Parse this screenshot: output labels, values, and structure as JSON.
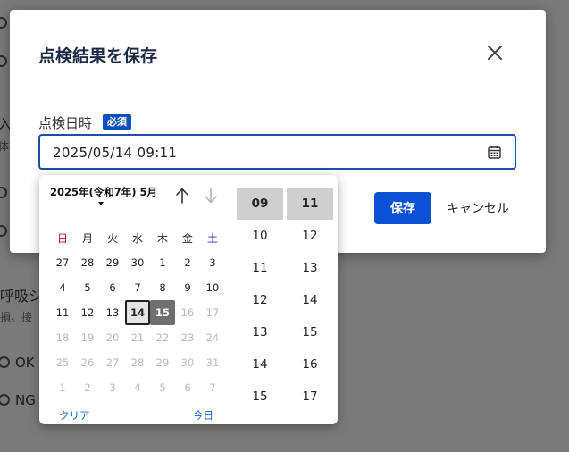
{
  "background": {
    "frag_a": "入",
    "frag_b": "体",
    "frag_c": "呼吸シ",
    "frag_d": "損、接",
    "ok_label": "OK",
    "ng_label": "NG"
  },
  "dialog": {
    "title": "点検結果を保存",
    "close_icon": "close-icon",
    "field_label": "点検日時",
    "required_badge": "必須",
    "datetime_value": "2025/05/14 09:11",
    "calendar_icon": "calendar-icon",
    "save_label": "保存",
    "cancel_label": "キャンセル",
    "accent_color": "#0a52d3"
  },
  "picker": {
    "month_label": "2025年(令和7年) 5月",
    "prev_icon": "arrow-up-icon",
    "next_icon": "arrow-down-icon",
    "weekdays": [
      "日",
      "月",
      "火",
      "水",
      "木",
      "金",
      "土"
    ],
    "weeks": [
      [
        {
          "d": "27",
          "m": "cur"
        },
        {
          "d": "28",
          "m": "cur"
        },
        {
          "d": "29",
          "m": "cur"
        },
        {
          "d": "30",
          "m": "cur"
        },
        {
          "d": "1",
          "m": "cur"
        },
        {
          "d": "2",
          "m": "cur"
        },
        {
          "d": "3",
          "m": "cur"
        }
      ],
      [
        {
          "d": "4",
          "m": "cur"
        },
        {
          "d": "5",
          "m": "cur"
        },
        {
          "d": "6",
          "m": "cur"
        },
        {
          "d": "7",
          "m": "cur"
        },
        {
          "d": "8",
          "m": "cur"
        },
        {
          "d": "9",
          "m": "cur"
        },
        {
          "d": "10",
          "m": "cur"
        }
      ],
      [
        {
          "d": "11",
          "m": "cur"
        },
        {
          "d": "12",
          "m": "cur"
        },
        {
          "d": "13",
          "m": "cur"
        },
        {
          "d": "14",
          "m": "today"
        },
        {
          "d": "15",
          "m": "sel"
        },
        {
          "d": "16",
          "m": "dim"
        },
        {
          "d": "17",
          "m": "dim"
        }
      ],
      [
        {
          "d": "18",
          "m": "dim"
        },
        {
          "d": "19",
          "m": "dim"
        },
        {
          "d": "20",
          "m": "dim"
        },
        {
          "d": "21",
          "m": "dim"
        },
        {
          "d": "22",
          "m": "dim"
        },
        {
          "d": "23",
          "m": "dim"
        },
        {
          "d": "24",
          "m": "dim"
        }
      ],
      [
        {
          "d": "25",
          "m": "dim"
        },
        {
          "d": "26",
          "m": "dim"
        },
        {
          "d": "27",
          "m": "dim"
        },
        {
          "d": "28",
          "m": "dim"
        },
        {
          "d": "29",
          "m": "dim"
        },
        {
          "d": "30",
          "m": "dim"
        },
        {
          "d": "31",
          "m": "dim"
        }
      ],
      [
        {
          "d": "1",
          "m": "dim"
        },
        {
          "d": "2",
          "m": "dim"
        },
        {
          "d": "3",
          "m": "dim"
        },
        {
          "d": "4",
          "m": "dim"
        },
        {
          "d": "5",
          "m": "dim"
        },
        {
          "d": "6",
          "m": "dim"
        },
        {
          "d": "7",
          "m": "dim"
        }
      ]
    ],
    "clear_label": "クリア",
    "today_label": "今日",
    "hours": [
      "09",
      "10",
      "11",
      "12",
      "13",
      "14",
      "15"
    ],
    "minutes": [
      "11",
      "12",
      "13",
      "14",
      "15",
      "16",
      "17"
    ],
    "selected_hour": "09",
    "selected_minute": "11"
  }
}
